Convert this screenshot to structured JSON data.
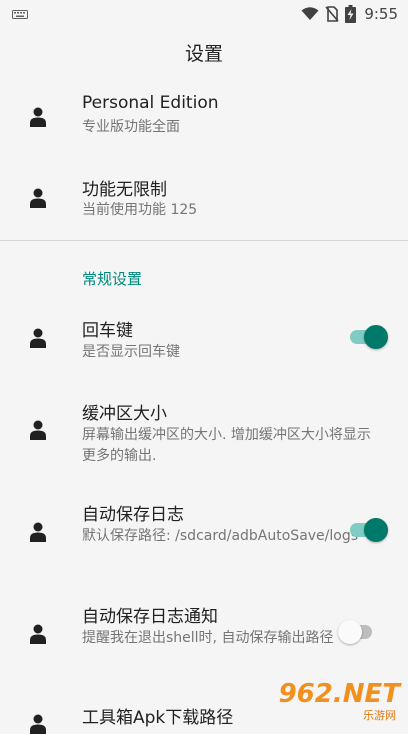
{
  "status_bar": {
    "time": "9:55",
    "icons": [
      "keyboard-icon",
      "wifi-icon",
      "no-sim-icon",
      "battery-charging-icon"
    ]
  },
  "app_bar": {
    "title": "设置"
  },
  "items": [
    {
      "title": "Personal Edition",
      "subtitle": "专业版功能全面",
      "icon": "person-icon"
    },
    {
      "title": "功能无限制",
      "subtitle": "当前使用功能  125",
      "icon": "person-icon"
    }
  ],
  "section": {
    "header": "常规设置"
  },
  "settings": [
    {
      "title": "回车键",
      "subtitle": "是否显示回车键",
      "icon": "person-icon",
      "switch": "on"
    },
    {
      "title": "缓冲区大小",
      "subtitle": "屏幕输出缓冲区的大小. 增加缓冲区大小将显示更多的输出.",
      "icon": "person-icon"
    },
    {
      "title": "自动保存日志",
      "subtitle": "默认保存路径: /sdcard/adbAutoSave/logs",
      "icon": "person-icon",
      "switch": "on"
    },
    {
      "title": "自动保存日志通知",
      "subtitle": "提醒我在退出shell时, 自动保存输出路径",
      "icon": "person-icon",
      "switch": "off"
    },
    {
      "title": "工具箱Apk下载路径",
      "icon": "person-icon"
    }
  ],
  "colors": {
    "accent": "#00796b",
    "section_header": "#00897b",
    "background": "#f5f5f5"
  },
  "watermark": {
    "main": "962.NET",
    "sub": "乐游网"
  }
}
